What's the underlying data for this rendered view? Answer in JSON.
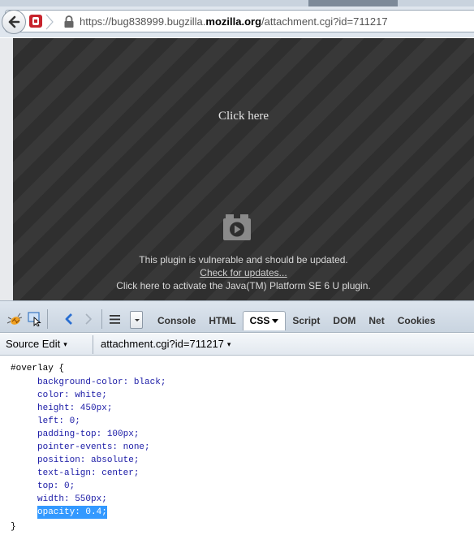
{
  "browser": {
    "url_prefix": "https://bug838999.bugzilla.",
    "url_host": "mozilla.org",
    "url_path": "/attachment.cgi?id=711217"
  },
  "plugin": {
    "click_here": "Click here",
    "vulnerable_msg": "This plugin is vulnerable and should be updated.",
    "check_updates": "Check for updates...",
    "activate_msg": "Click here to activate the Java(TM) Platform SE 6 U plugin."
  },
  "firebug": {
    "tabs": [
      "Console",
      "HTML",
      "CSS",
      "Script",
      "DOM",
      "Net",
      "Cookies"
    ],
    "active_tab": "CSS",
    "source_mode": "Source Edit",
    "file": "attachment.cgi?id=711217"
  },
  "css_rule": {
    "selector": "#overlay {",
    "declarations": [
      "background-color: black;",
      "color: white;",
      "height: 450px;",
      "left: 0;",
      "padding-top: 100px;",
      "pointer-events: none;",
      "position: absolute;",
      "text-align: center;",
      "top: 0;",
      "width: 550px;",
      "opacity: 0.4;"
    ],
    "close": "}"
  }
}
